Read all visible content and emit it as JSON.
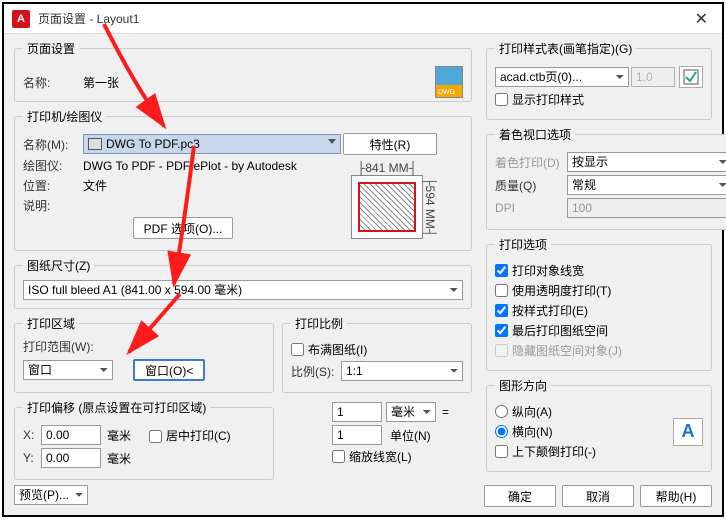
{
  "window": {
    "title": "页面设置 - Layout1"
  },
  "pageSetup": {
    "legend": "页面设置",
    "nameLabel": "名称:",
    "nameValue": "第一张"
  },
  "printer": {
    "legend": "打印机/绘图仪",
    "nameLabel": "名称(M):",
    "deviceName": "DWG To PDF.pc3",
    "propsBtn": "特性(R)",
    "plotterLabel": "绘图仪:",
    "plotterValue": "DWG To PDF - PDF ePlot - by Autodesk",
    "locationLabel": "位置:",
    "locationValue": "文件",
    "descLabel": "说明:",
    "pdfOptionsBtn": "PDF 选项(O)...",
    "widthLabel": "841 MM",
    "heightLabel": "594 MM"
  },
  "paperSize": {
    "legend": "图纸尺寸(Z)",
    "value": "ISO full bleed A1 (841.00 x 594.00 毫米)"
  },
  "plotArea": {
    "legend": "打印区域",
    "rangeLabel": "打印范围(W):",
    "rangeValue": "窗口",
    "windowBtn": "窗口(O)<"
  },
  "offset": {
    "legend": "打印偏移 (原点设置在可打印区域)",
    "xLabel": "X:",
    "xValue": "0.00",
    "yLabel": "Y:",
    "yValue": "0.00",
    "unit": "毫米",
    "center": "居中打印(C)"
  },
  "scale": {
    "legend": "打印比例",
    "fit": "布满图纸(I)",
    "scaleLabel": "比例(S):",
    "scaleValue": "1:1",
    "num": "1",
    "numUnit": "毫米",
    "eq": "=",
    "den": "1",
    "denUnit": "单位(N)",
    "scaleLw": "缩放线宽(L)"
  },
  "styleTable": {
    "legend": "打印样式表(画笔指定)(G)",
    "value": "acad.ctb页(0)...",
    "slider": "1.0",
    "showStyles": "显示打印样式"
  },
  "shaded": {
    "legend": "着色视口选项",
    "shadeLabel": "着色打印(D)",
    "shadeValue": "按显示",
    "qualityLabel": "质量(Q)",
    "qualityValue": "常规",
    "dpiLabel": "DPI",
    "dpiValue": "100"
  },
  "options": {
    "legend": "打印选项",
    "lw": "打印对象线宽",
    "trans": "使用透明度打印(T)",
    "byStyle": "按样式打印(E)",
    "last": "最后打印图纸空间",
    "hide": "隐藏图纸空间对象(J)"
  },
  "orient": {
    "legend": "图形方向",
    "portrait": "纵向(A)",
    "landscape": "横向(N)",
    "upside": "上下颠倒打印(-)"
  },
  "footer": {
    "preview": "预览(P)...",
    "ok": "确定",
    "cancel": "取消",
    "help": "帮助(H)"
  }
}
